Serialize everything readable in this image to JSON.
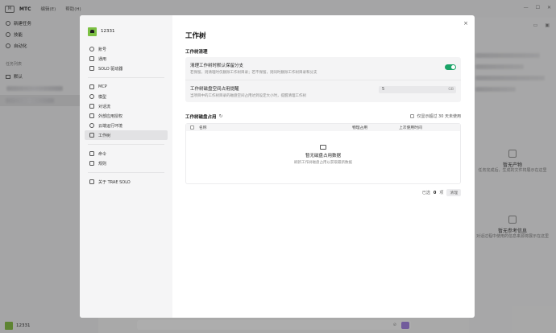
{
  "app": {
    "logo_text": "M",
    "name": "MTC",
    "menus": [
      "编辑(E)",
      "帮助(H)"
    ],
    "nav": [
      {
        "label": "新建任务",
        "icon": "plus-circle-icon"
      },
      {
        "label": "技能",
        "icon": "skill-icon"
      },
      {
        "label": "自动化",
        "icon": "automation-icon"
      }
    ],
    "task_section": "任务列表",
    "active_task": "默认",
    "user": "12331"
  },
  "right_panel": {
    "artifacts_title": "暂无产物",
    "artifacts_desc": "任务完成后，生成的文件将展示在这里",
    "refs_title": "暂无参考信息",
    "refs_desc": "对话过程中使用的信息来源将展示在这里"
  },
  "modal": {
    "user_name": "12331",
    "nav": [
      {
        "label": "账号",
        "icon": "account-icon",
        "group": 1
      },
      {
        "label": "通用",
        "icon": "general-icon",
        "group": 1
      },
      {
        "label": "SOLO 驱动器",
        "icon": "solo-icon",
        "group": 1
      },
      {
        "label": "MCP",
        "icon": "mcp-icon",
        "group": 2
      },
      {
        "label": "模型",
        "icon": "model-icon",
        "group": 2
      },
      {
        "label": "对话流",
        "icon": "dialog-icon",
        "group": 2
      },
      {
        "label": "外部应用授权",
        "icon": "external-auth-icon",
        "group": 2
      },
      {
        "label": "云端运行环境",
        "icon": "cloud-icon",
        "group": 2
      },
      {
        "label": "工作树",
        "icon": "worktree-icon",
        "group": 2,
        "active": true
      },
      {
        "label": "命令",
        "icon": "command-icon",
        "group": 3
      },
      {
        "label": "规则",
        "icon": "rules-icon",
        "group": 3
      },
      {
        "label": "关于 TRAE SOLO",
        "icon": "about-icon",
        "group": 4
      }
    ],
    "close_symbol": "×",
    "title": "工作树",
    "cleanup_section": "工作树清理",
    "rows": {
      "keep_branch_label": "清理工作树时默认保留分支",
      "keep_branch_desc": "若保留，则清理时仅删除工作树目录；若不保留，则同时删除工作树目录和分支",
      "keep_branch_enabled": true,
      "disk_alert_label": "工作树磁盘空间占用提醒",
      "disk_alert_desc": "当项目中的工作树目录的磁盘空间占用达到设定大小时，提醒清理工作树",
      "disk_alert_value": "5",
      "disk_alert_unit": "GB"
    },
    "usage": {
      "title": "工作树磁盘占用",
      "refresh_icon": "↻",
      "filter_label": "仅显示超过 30 天未使用",
      "columns": [
        "名称",
        "物理占用",
        "上次使用时间"
      ],
      "empty_title": "暂无磁盘占用数据",
      "empty_desc": "刷新工作树磁盘占用以获取最新数据"
    },
    "footer": {
      "selected_label": "已选",
      "selected_count": "0",
      "selected_unit": "项",
      "cleanup_button": "清理"
    }
  }
}
